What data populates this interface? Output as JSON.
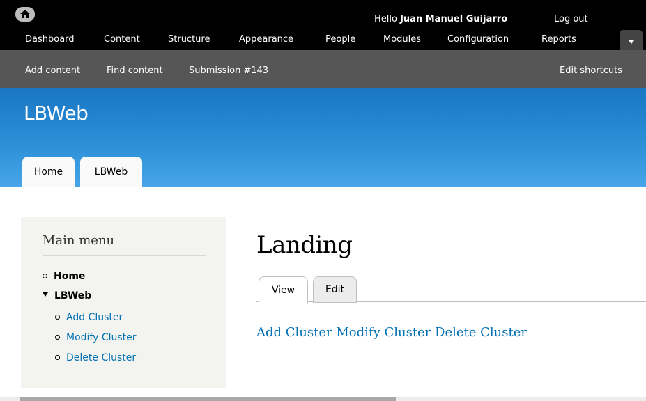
{
  "toolbar": {
    "home_icon": "home-icon",
    "greeting_prefix": "Hello",
    "user_name": "Juan Manuel Guijarro",
    "logout": "Log out",
    "menu": [
      "Dashboard",
      "Content",
      "Structure",
      "Appearance",
      "People",
      "Modules",
      "Configuration",
      "Reports"
    ],
    "drawer_icon": "chevron-down-icon"
  },
  "shortcuts": {
    "items": [
      "Add content",
      "Find content",
      "Submission #143"
    ],
    "edit": "Edit shortcuts"
  },
  "header": {
    "site_name": "LBWeb",
    "tabs": [
      "Home",
      "LBWeb"
    ]
  },
  "sidebar": {
    "title": "Main menu",
    "items": [
      {
        "label": "Home"
      },
      {
        "label": "LBWeb"
      }
    ],
    "subitems": [
      {
        "label": "Add Cluster"
      },
      {
        "label": "Modify Cluster"
      },
      {
        "label": "Delete Cluster"
      }
    ]
  },
  "main": {
    "title": "Landing",
    "tabs": [
      "View",
      "Edit"
    ],
    "links": [
      "Add Cluster",
      "Modify Cluster",
      "Delete Cluster"
    ]
  },
  "colors": {
    "toolbar": "#000000",
    "shortcuts": "#565656",
    "header_top": "#1a76c3",
    "header_bottom": "#48a5e8",
    "link": "#0071b3"
  }
}
